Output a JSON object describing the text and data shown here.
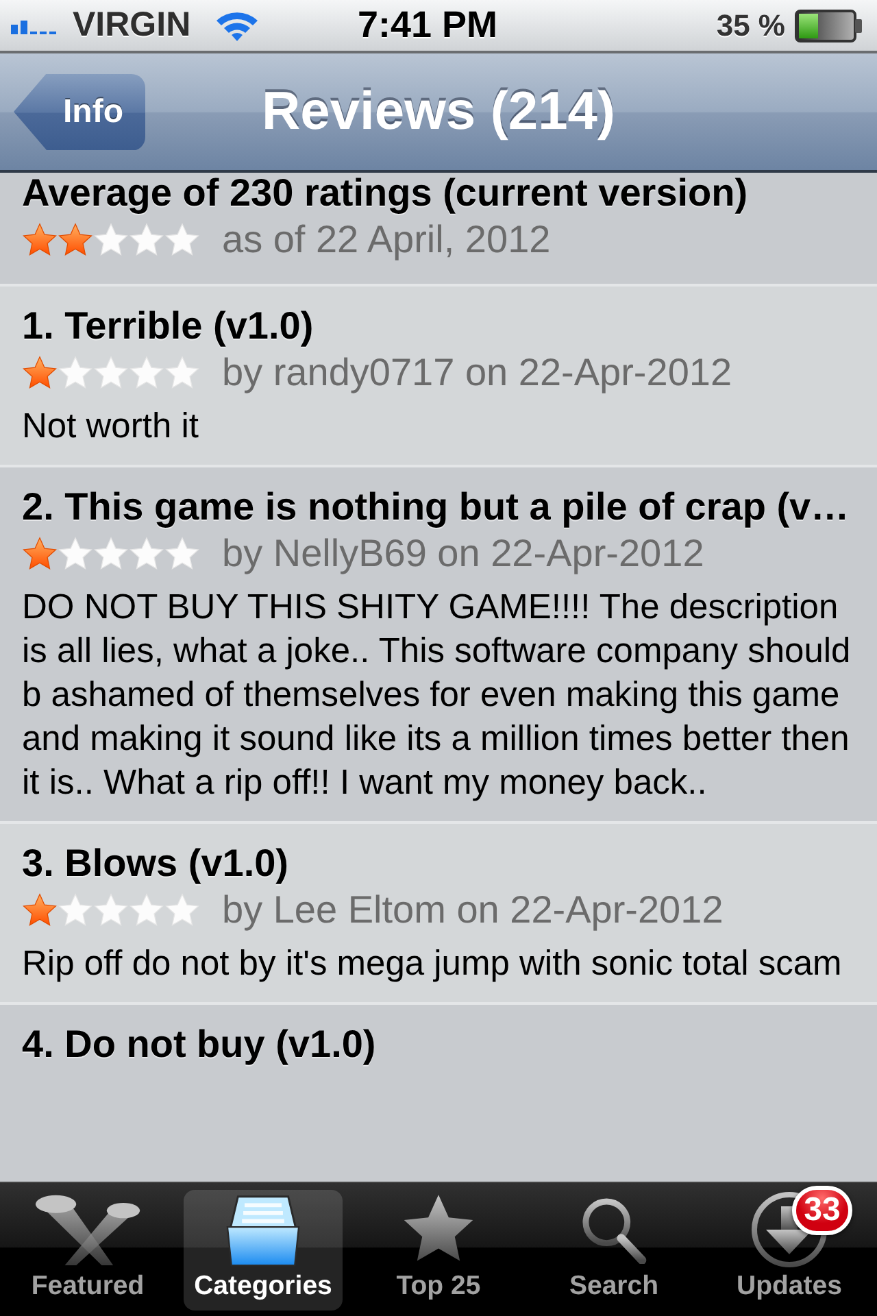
{
  "status_bar": {
    "carrier": "VIRGIN",
    "time": "7:41 PM",
    "battery": "35 %"
  },
  "nav_bar": {
    "back_button": "Info",
    "title": "Reviews (214)"
  },
  "summary": {
    "title": "Average of 230 ratings (current version)",
    "stars": 2,
    "date": "as of 22 April, 2012"
  },
  "reviews": [
    {
      "title": "1. Terrible (v1.0)",
      "stars": 1,
      "byline": "by randy0717 on 22-Apr-2012",
      "body": "Not worth it"
    },
    {
      "title": "2. This game is nothing but a pile of crap (v…",
      "stars": 1,
      "byline": "by NellyB69 on 22-Apr-2012",
      "body": "DO NOT BUY THIS SHITY GAME!!!! The description is all lies, what a joke.. This software company should b ashamed of themselves for even making this game and making it sound like its a million times better then it is.. What a rip off!! I want my money back.."
    },
    {
      "title": "3. Blows (v1.0)",
      "stars": 1,
      "byline": "by Lee Eltom on 22-Apr-2012",
      "body": "Rip off do not by it's mega jump with sonic total scam"
    },
    {
      "title": "4. Do not buy (v1.0)"
    }
  ],
  "tab_bar": [
    {
      "kind": "featured",
      "label": "Featured",
      "selected": false
    },
    {
      "kind": "categories",
      "label": "Categories",
      "selected": true
    },
    {
      "kind": "top",
      "label": "Top 25",
      "selected": false
    },
    {
      "kind": "search",
      "label": "Search",
      "selected": false
    },
    {
      "kind": "updates",
      "label": "Updates",
      "selected": false,
      "badge": "33"
    }
  ]
}
